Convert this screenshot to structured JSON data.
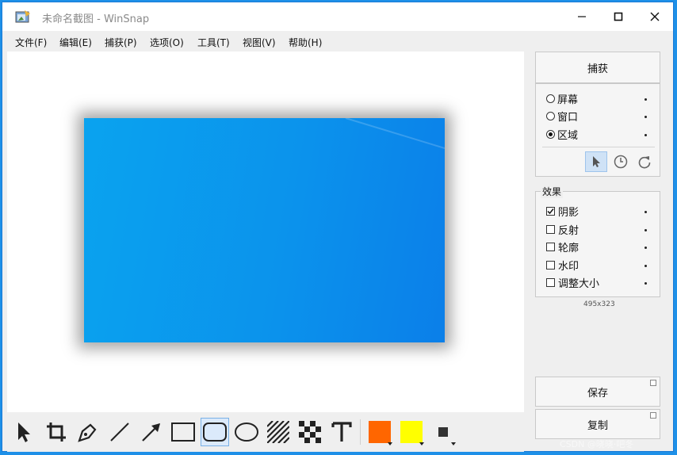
{
  "window": {
    "title": "未命名截图 - WinSnap"
  },
  "titlebar": {
    "minimize_icon": "minimize-icon",
    "maximize_icon": "maximize-icon",
    "close_icon": "close-icon"
  },
  "menu": [
    "文件(F)",
    "编辑(E)",
    "捕获(P)",
    "选项(O)",
    "工具(T)",
    "视图(V)",
    "帮助(H)"
  ],
  "capture": {
    "button": "捕获",
    "modes": [
      {
        "label": "屏幕",
        "selected": false
      },
      {
        "label": "窗口",
        "selected": false
      },
      {
        "label": "区域",
        "selected": true
      }
    ],
    "tools": [
      "cursor-icon",
      "timer-icon",
      "repeat-icon"
    ]
  },
  "effects": {
    "title": "效果",
    "items": [
      {
        "label": "阴影",
        "checked": true
      },
      {
        "label": "反射",
        "checked": false
      },
      {
        "label": "轮廓",
        "checked": false
      },
      {
        "label": "水印",
        "checked": false
      },
      {
        "label": "调整大小",
        "checked": false
      }
    ]
  },
  "size_text": "495x323",
  "actions": {
    "save": "保存",
    "copy": "复制"
  },
  "drawing_tools": [
    "pointer-icon",
    "crop-icon",
    "pen-icon",
    "line-icon",
    "arrow-icon",
    "rectangle-icon",
    "rounded-rectangle-icon",
    "ellipse-icon",
    "hatch-icon",
    "pixelate-icon",
    "text-icon"
  ],
  "colors": {
    "primary": "#ff6600",
    "secondary": "#ffff00",
    "line_style": "#333333",
    "accent": "#1a7ad6",
    "desktop": "#0b93ec"
  },
  "watermark": "CSDN @晓晓·吧冬"
}
